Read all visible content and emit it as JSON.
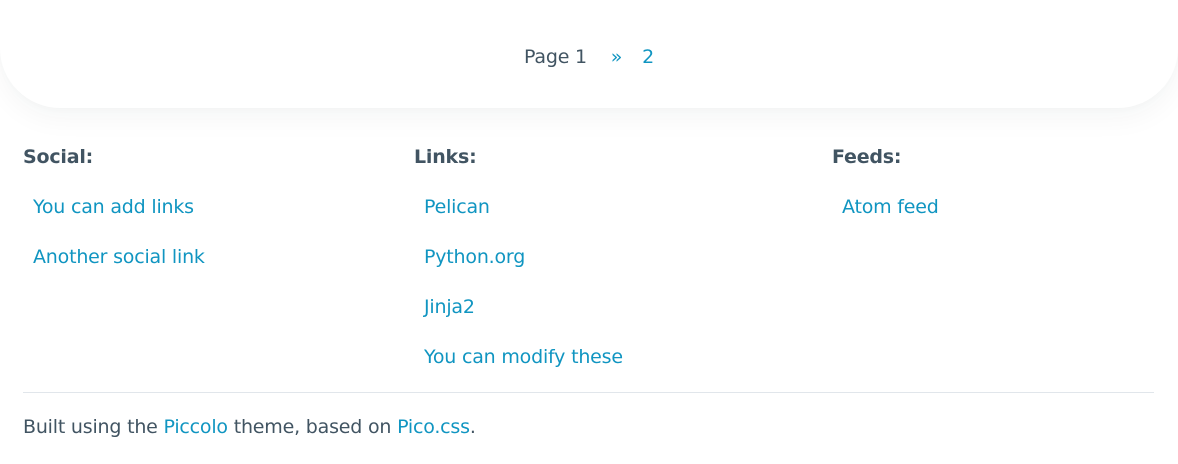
{
  "pagination": {
    "current_label": "Page 1",
    "next_arrow": "»",
    "next_page": "2"
  },
  "footer": {
    "social": {
      "heading": "Social:",
      "items": [
        {
          "label": "You can add links"
        },
        {
          "label": "Another social link"
        }
      ]
    },
    "links": {
      "heading": "Links:",
      "items": [
        {
          "label": "Pelican"
        },
        {
          "label": "Python.org"
        },
        {
          "label": "Jinja2"
        },
        {
          "label": "You can modify these"
        }
      ]
    },
    "feeds": {
      "heading": "Feeds:",
      "items": [
        {
          "label": "Atom feed"
        }
      ]
    }
  },
  "credit": {
    "prefix": "Built using the",
    "theme_link": "Piccolo",
    "middle": "theme, based on",
    "css_link": "Pico.css",
    "suffix": "."
  },
  "colors": {
    "link": "#1095c1",
    "text": "#415462",
    "divider": "#e1e6eb"
  }
}
